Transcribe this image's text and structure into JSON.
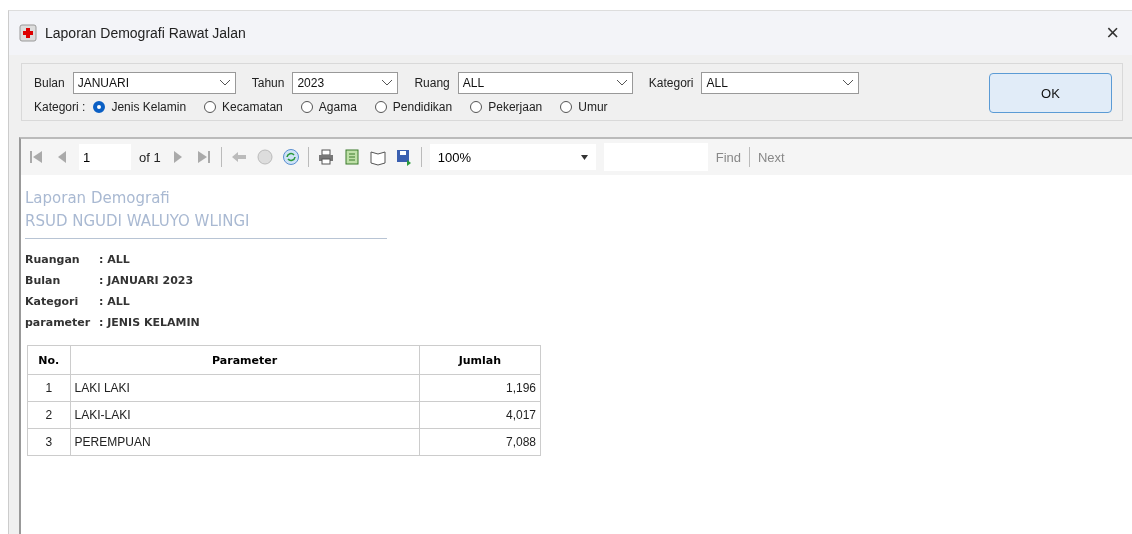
{
  "window": {
    "title": "Laporan Demografi Rawat Jalan",
    "close": "×"
  },
  "filters": [
    {
      "label": "Bulan",
      "value": "JANUARI"
    },
    {
      "label": "Tahun",
      "value": "2023"
    },
    {
      "label": "Ruang",
      "value": "ALL"
    },
    {
      "label": "Kategori",
      "value": "ALL"
    }
  ],
  "kategori_label": "Kategori :",
  "radios": [
    {
      "label": "Jenis Kelamin",
      "selected": true
    },
    {
      "label": "Kecamatan",
      "selected": false
    },
    {
      "label": "Agama",
      "selected": false
    },
    {
      "label": "Pendidikan",
      "selected": false
    },
    {
      "label": "Pekerjaan",
      "selected": false
    },
    {
      "label": "Umur",
      "selected": false
    }
  ],
  "ok_button": "OK",
  "toolbar": {
    "page": "1",
    "of": "of 1",
    "zoom": "100%",
    "find": "Find",
    "next": "Next"
  },
  "report": {
    "title": "Laporan Demografi",
    "subtitle": "RSUD NGUDI WALUYO WLINGI",
    "info": [
      {
        "label": "Ruangan",
        "value": ": ALL"
      },
      {
        "label": "Bulan",
        "value": ": JANUARI 2023"
      },
      {
        "label": "Kategori",
        "value": ": ALL"
      },
      {
        "label": "parameter",
        "value": ": JENIS KELAMIN"
      }
    ],
    "columns": [
      "No.",
      "Parameter",
      "Jumlah"
    ],
    "rows": [
      [
        "1",
        "LAKI LAKI",
        "1,196"
      ],
      [
        "2",
        "LAKI-LAKI",
        "4,017"
      ],
      [
        "3",
        "PEREMPUAN",
        "7,088"
      ]
    ]
  }
}
